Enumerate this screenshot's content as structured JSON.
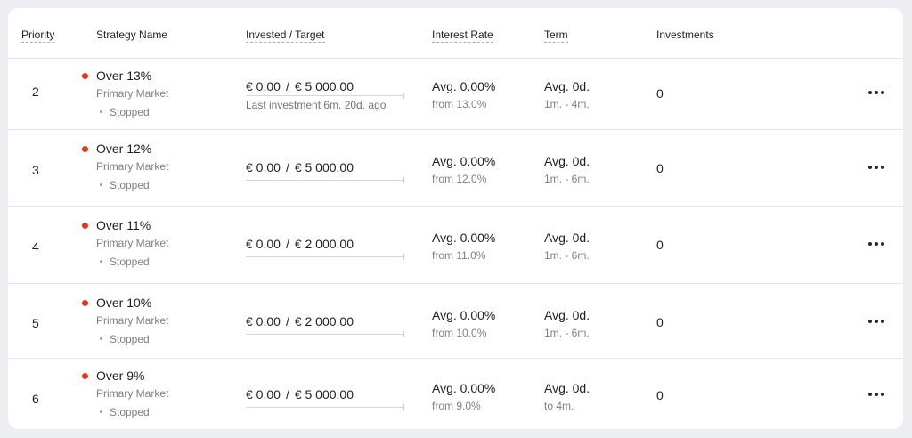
{
  "header": {
    "priority": "Priority",
    "strategy_name": "Strategy Name",
    "invested_target": "Invested / Target",
    "interest_rate": "Interest Rate",
    "term": "Term",
    "investments": "Investments"
  },
  "rows": [
    {
      "priority": "2",
      "name": "Over 13%",
      "market": "Primary Market",
      "status": "Stopped",
      "invested": "€ 0.00",
      "separator": "/",
      "target": "€ 5 000.00",
      "last_investment": "Last investment 6m. 20d. ago",
      "rate": "Avg. 0.00%",
      "rate_from": "from 13.0%",
      "term": "Avg. 0d.",
      "term_range": "1m. - 4m.",
      "investments": "0"
    },
    {
      "priority": "3",
      "name": "Over 12%",
      "market": "Primary Market",
      "status": "Stopped",
      "invested": "€ 0.00",
      "separator": "/",
      "target": "€ 5 000.00",
      "last_investment": "",
      "rate": "Avg. 0.00%",
      "rate_from": "from 12.0%",
      "term": "Avg. 0d.",
      "term_range": "1m. - 6m.",
      "investments": "0"
    },
    {
      "priority": "4",
      "name": "Over 11%",
      "market": "Primary Market",
      "status": "Stopped",
      "invested": "€ 0.00",
      "separator": "/",
      "target": "€ 2 000.00",
      "last_investment": "",
      "rate": "Avg. 0.00%",
      "rate_from": "from 11.0%",
      "term": "Avg. 0d.",
      "term_range": "1m. - 6m.",
      "investments": "0"
    },
    {
      "priority": "5",
      "name": "Over 10%",
      "market": "Primary Market",
      "status": "Stopped",
      "invested": "€ 0.00",
      "separator": "/",
      "target": "€ 2 000.00",
      "last_investment": "",
      "rate": "Avg. 0.00%",
      "rate_from": "from 10.0%",
      "term": "Avg. 0d.",
      "term_range": "1m. - 6m.",
      "investments": "0"
    },
    {
      "priority": "6",
      "name": "Over 9%",
      "market": "Primary Market",
      "status": "Stopped",
      "invested": "€ 0.00",
      "separator": "/",
      "target": "€ 5 000.00",
      "last_investment": "",
      "rate": "Avg. 0.00%",
      "rate_from": "from 9.0%",
      "term": "Avg. 0d.",
      "term_range": "to 4m.",
      "investments": "0"
    }
  ],
  "colors": {
    "status_stopped": "#d83a22"
  },
  "icons": {
    "row_menu": "more-horizontal-icon"
  }
}
